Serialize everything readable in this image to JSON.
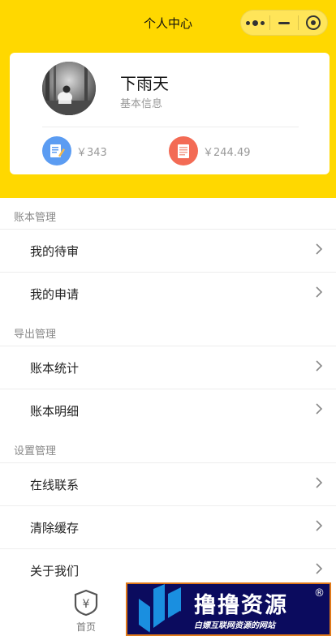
{
  "header": {
    "title": "个人中心"
  },
  "profile": {
    "name": "下雨天",
    "subtitle": "基本信息",
    "stats": [
      {
        "value": "￥343",
        "icon": "memo-pencil-icon",
        "color": "#5b9cf2"
      },
      {
        "value": "￥244.49",
        "icon": "document-list-icon",
        "color": "#f36b55"
      }
    ]
  },
  "sections": [
    {
      "title": "账本管理",
      "items": [
        "我的待审",
        "我的申请"
      ]
    },
    {
      "title": "导出管理",
      "items": [
        "账本统计",
        "账本明细"
      ]
    },
    {
      "title": "设置管理",
      "items": [
        "在线联系",
        "清除缓存",
        "关于我们"
      ]
    }
  ],
  "tabbar": {
    "home_label": "首页",
    "home_glyph": "¥"
  },
  "watermark": {
    "title": "撸撸资源",
    "subtitle": "白嫖互联网资源的网站",
    "mark": "®"
  },
  "colors": {
    "brand": "#ffd800",
    "watermark_bg": "#0b0b5e",
    "watermark_border": "#e07a1a"
  }
}
